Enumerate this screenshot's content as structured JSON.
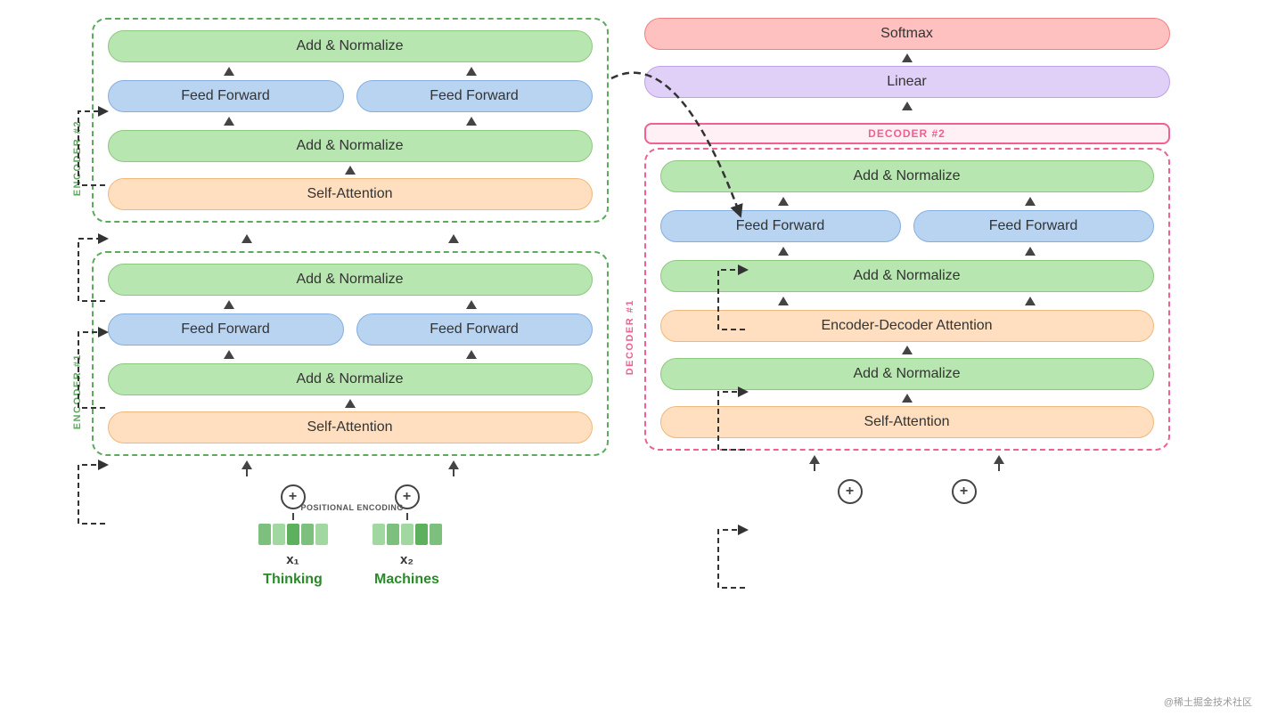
{
  "encoder": {
    "label1": "ENCODER #1",
    "label2": "ENCODER #2",
    "blocks": [
      {
        "self_attention": "Self-Attention",
        "add_norm1": "Add & Normalize",
        "ff1": "Feed Forward",
        "ff2": "Feed Forward",
        "add_norm2": "Add & Normalize"
      },
      {
        "self_attention": "Self-Attention",
        "add_norm1": "Add & Normalize",
        "ff1": "Feed Forward",
        "ff2": "Feed Forward",
        "add_norm2": "Add & Normalize"
      }
    ],
    "positional_encoding": "POSITIONAL ENCODING",
    "plus_symbol": "⊕",
    "inputs": [
      {
        "var": "x₁",
        "word": "Thinking"
      },
      {
        "var": "x₂",
        "word": "Machines"
      }
    ]
  },
  "decoder": {
    "label1": "DECODER #1",
    "label2": "DECODER #2",
    "block1": {
      "self_attention": "Self-Attention",
      "add_norm1": "Add & Normalize",
      "enc_dec_attention": "Encoder-Decoder Attention",
      "add_norm2": "Add & Normalize",
      "ff1": "Feed Forward",
      "ff2": "Feed Forward",
      "add_norm3": "Add & Normalize"
    },
    "linear": "Linear",
    "softmax": "Softmax",
    "plus_symbol": "⊕",
    "inputs": [
      {
        "var": ""
      },
      {
        "var": ""
      }
    ]
  },
  "watermark": "@稀土掘金技术社区"
}
